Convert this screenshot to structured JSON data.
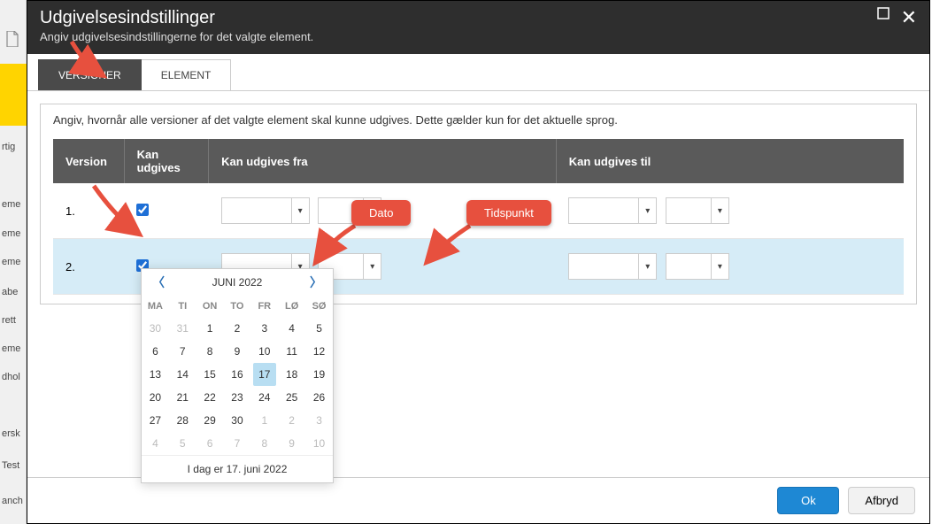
{
  "sidebar": {
    "doc_icon": "document-icon",
    "items": [
      "rtig",
      "eme",
      "eme",
      "eme",
      "abe",
      "rett",
      "eme",
      "dhol",
      "ersk",
      "Test",
      "anch"
    ]
  },
  "dialog": {
    "title": "Udgivelsesindstillinger",
    "subtitle": "Angiv udgivelsesindstillingerne for det valgte element."
  },
  "tabs": {
    "active": "VERSIONER",
    "other": "ELEMENT"
  },
  "body": {
    "description": "Angiv, hvornår alle versioner af det valgte element skal kunne udgives. Dette gælder kun for det aktuelle sprog."
  },
  "table": {
    "headers": {
      "version": "Version",
      "publish": "Kan udgives",
      "from": "Kan udgives fra",
      "to": "Kan udgives til"
    },
    "rows": [
      {
        "version": "1.",
        "checked": true
      },
      {
        "version": "2.",
        "checked": true
      }
    ]
  },
  "callouts": {
    "dato": "Dato",
    "tidspunkt": "Tidspunkt"
  },
  "datepicker": {
    "month_label": "JUNI 2022",
    "dow": [
      "MA",
      "TI",
      "ON",
      "TO",
      "FR",
      "LØ",
      "SØ"
    ],
    "weeks": [
      [
        {
          "d": "30",
          "o": true
        },
        {
          "d": "31",
          "o": true
        },
        {
          "d": "1"
        },
        {
          "d": "2"
        },
        {
          "d": "3"
        },
        {
          "d": "4"
        },
        {
          "d": "5"
        }
      ],
      [
        {
          "d": "6"
        },
        {
          "d": "7"
        },
        {
          "d": "8"
        },
        {
          "d": "9"
        },
        {
          "d": "10"
        },
        {
          "d": "11"
        },
        {
          "d": "12"
        }
      ],
      [
        {
          "d": "13"
        },
        {
          "d": "14"
        },
        {
          "d": "15"
        },
        {
          "d": "16"
        },
        {
          "d": "17",
          "today": true
        },
        {
          "d": "18"
        },
        {
          "d": "19"
        }
      ],
      [
        {
          "d": "20"
        },
        {
          "d": "21"
        },
        {
          "d": "22"
        },
        {
          "d": "23"
        },
        {
          "d": "24"
        },
        {
          "d": "25"
        },
        {
          "d": "26"
        }
      ],
      [
        {
          "d": "27"
        },
        {
          "d": "28"
        },
        {
          "d": "29"
        },
        {
          "d": "30"
        },
        {
          "d": "1",
          "o": true
        },
        {
          "d": "2",
          "o": true
        },
        {
          "d": "3",
          "o": true
        }
      ],
      [
        {
          "d": "4",
          "o": true
        },
        {
          "d": "5",
          "o": true
        },
        {
          "d": "6",
          "o": true
        },
        {
          "d": "7",
          "o": true
        },
        {
          "d": "8",
          "o": true
        },
        {
          "d": "9",
          "o": true
        },
        {
          "d": "10",
          "o": true
        }
      ]
    ],
    "today_label": "I dag er 17. juni 2022"
  },
  "footer": {
    "ok": "Ok",
    "cancel": "Afbryd"
  }
}
